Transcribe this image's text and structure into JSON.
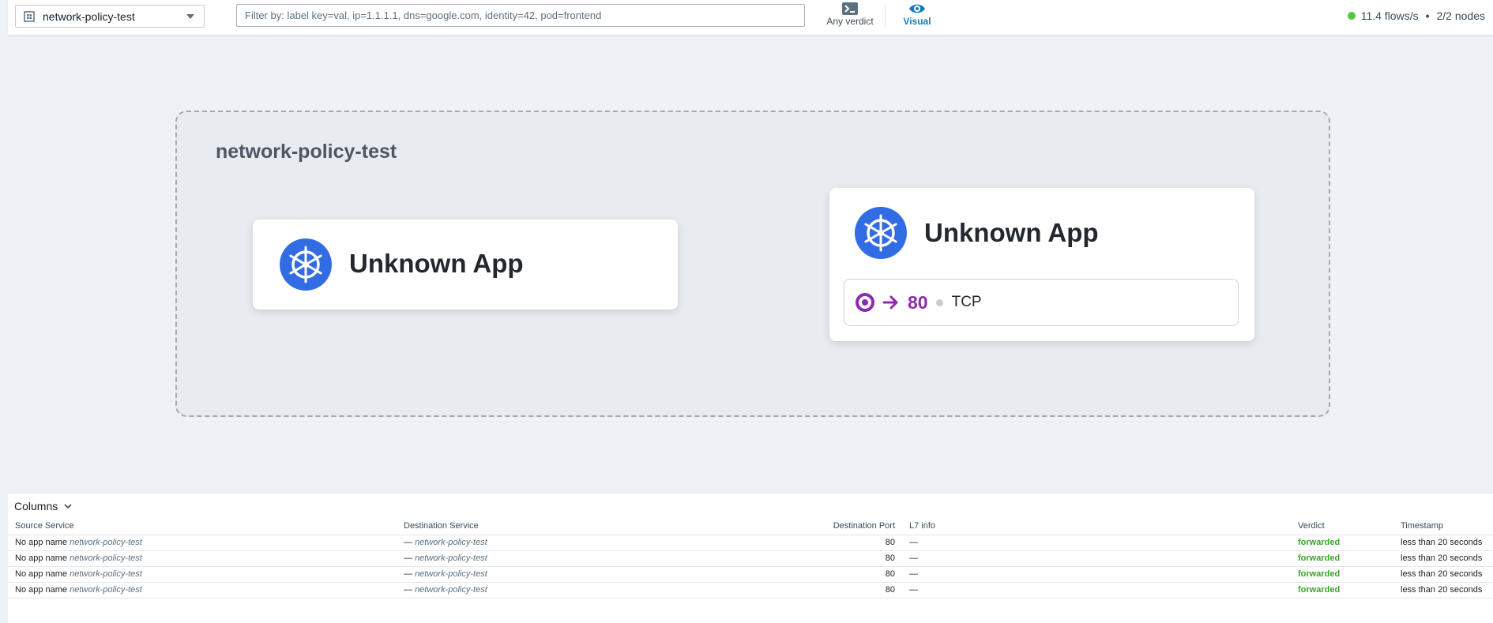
{
  "topbar": {
    "namespace": "network-policy-test",
    "filter_placeholder": "Filter by: label key=val, ip=1.1.1.1, dns=google.com, identity=42, pod=frontend",
    "verdict_label": "Any verdict",
    "visual_label": "Visual",
    "flows_rate": "11.4 flows/s",
    "separator": "•",
    "nodes": "2/2 nodes",
    "status_color": "#55c63f"
  },
  "canvas": {
    "namespace_title": "network-policy-test",
    "source_card": {
      "icon": "kubernetes-icon",
      "app_name": "Unknown App"
    },
    "destination_card": {
      "icon": "kubernetes-icon",
      "app_name": "Unknown App",
      "port": "80",
      "protocol": "TCP",
      "accent_color": "#8e2bb0"
    }
  },
  "flows": {
    "columns_label": "Columns",
    "headers": [
      "Source Service",
      "Destination Service",
      "Destination Port",
      "L7 info",
      "Verdict",
      "Timestamp"
    ],
    "rows": [
      {
        "src_app": "No app name",
        "src_ns": "network-policy-test",
        "dst_app": "—",
        "dst_ns": "network-policy-test",
        "port": "80",
        "l7": "—",
        "verdict": "forwarded",
        "timestamp": "less than 20 seconds"
      },
      {
        "src_app": "No app name",
        "src_ns": "network-policy-test",
        "dst_app": "—",
        "dst_ns": "network-policy-test",
        "port": "80",
        "l7": "—",
        "verdict": "forwarded",
        "timestamp": "less than 20 seconds"
      },
      {
        "src_app": "No app name",
        "src_ns": "network-policy-test",
        "dst_app": "—",
        "dst_ns": "network-policy-test",
        "port": "80",
        "l7": "—",
        "verdict": "forwarded",
        "timestamp": "less than 20 seconds"
      },
      {
        "src_app": "No app name",
        "src_ns": "network-policy-test",
        "dst_app": "—",
        "dst_ns": "network-policy-test",
        "port": "80",
        "l7": "—",
        "verdict": "forwarded",
        "timestamp": "less than 20 seconds"
      }
    ]
  }
}
